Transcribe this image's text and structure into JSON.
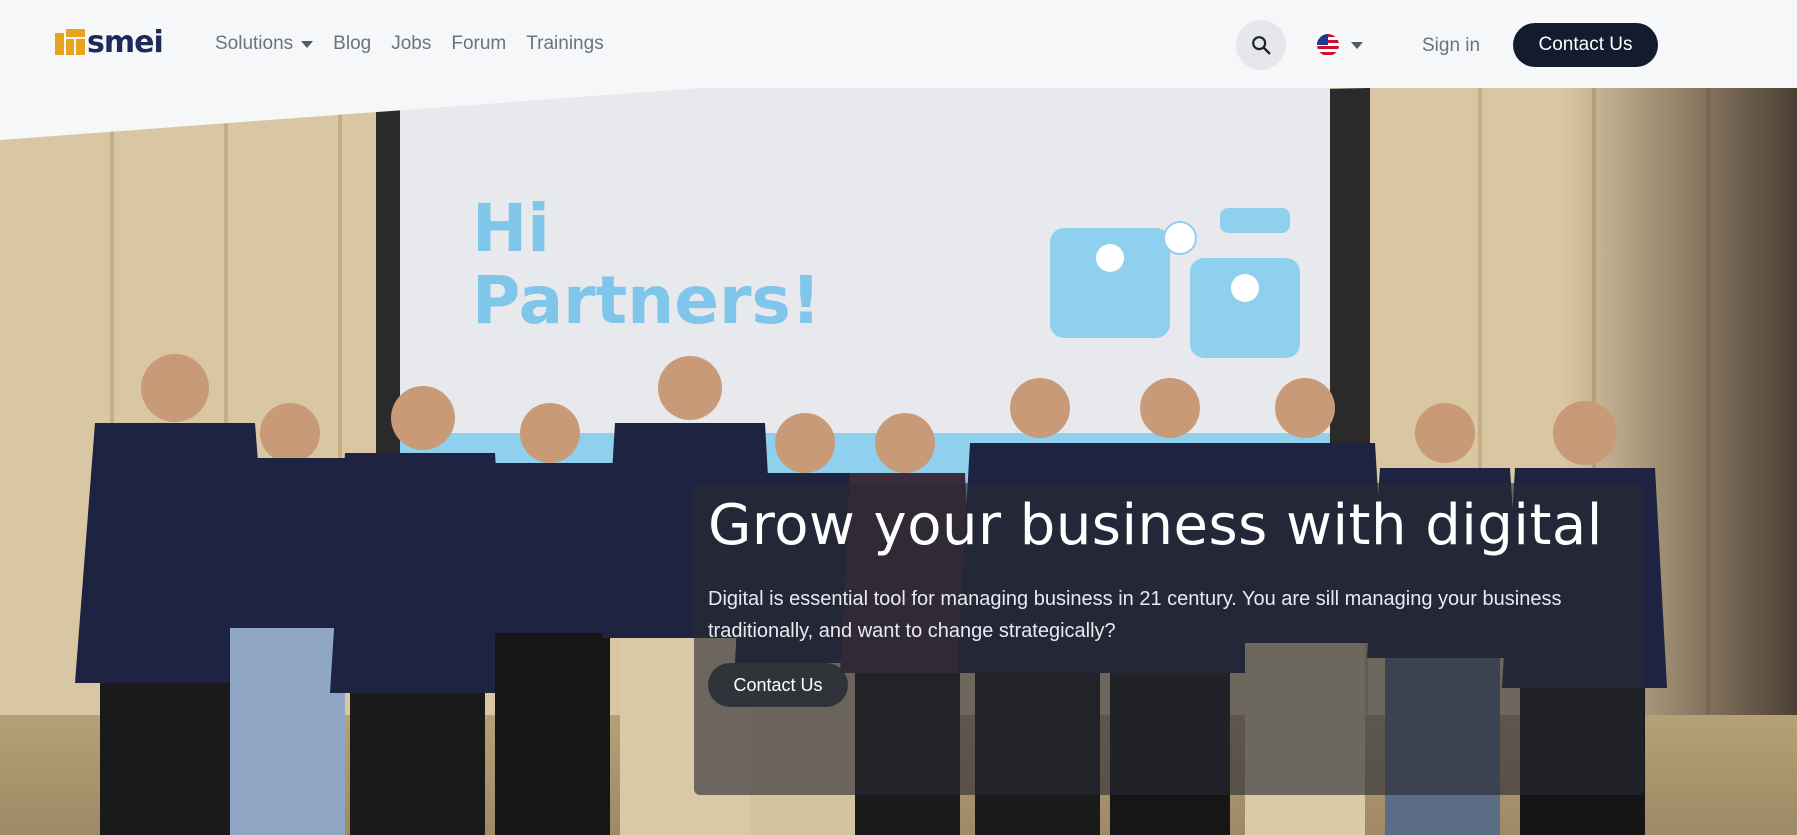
{
  "brand": {
    "name": "smei",
    "accent": "#e8a41c",
    "text_color": "#1c2a5c"
  },
  "nav": {
    "items": [
      {
        "label": "Solutions",
        "has_dropdown": true
      },
      {
        "label": "Blog"
      },
      {
        "label": "Jobs"
      },
      {
        "label": "Forum"
      },
      {
        "label": "Trainings"
      }
    ],
    "search_icon": "search-icon",
    "language_flag": "us-flag-icon",
    "signin_label": "Sign in",
    "contact_label": "Contact Us"
  },
  "hero": {
    "screen_text_line1": "Hi",
    "screen_text_line2": "Partners!",
    "title": "Grow your business with digital",
    "description": "Digital is essential tool for managing business in 21 century. You are sill managing your business traditionally, and want to change strategically?",
    "cta_label": "Contact Us"
  },
  "colors": {
    "nav_bg": "#f6f7f9",
    "primary_button": "#131c2e",
    "overlay": "rgba(40,42,50,0.62)"
  }
}
